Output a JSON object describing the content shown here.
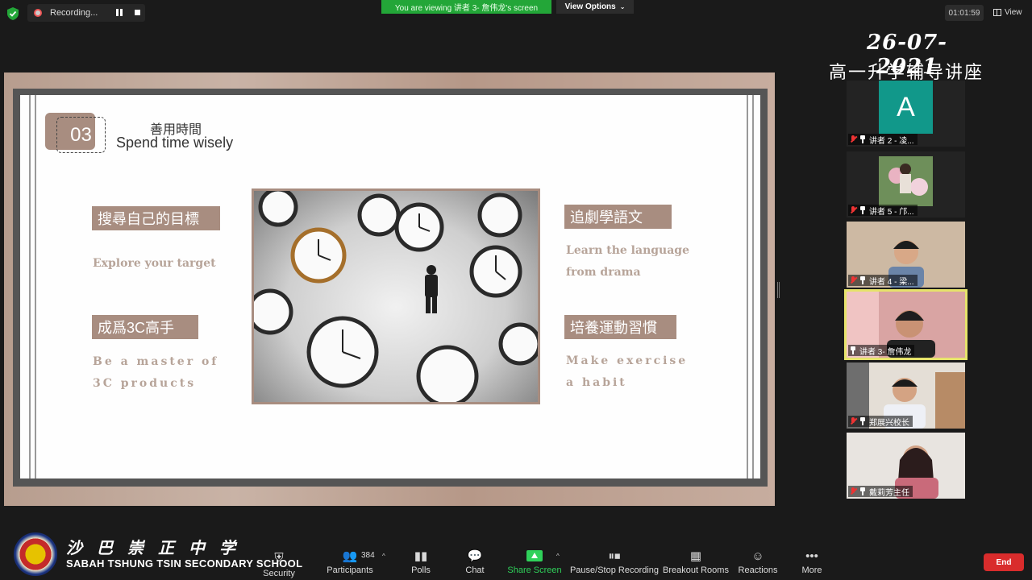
{
  "top_bar": {
    "recording_label": "Recording...",
    "viewing_banner": "You are viewing 讲者 3- 詹伟龙's screen",
    "view_options_label": "View Options",
    "timer": "01:01:59",
    "view_label": "View"
  },
  "overlay": {
    "date": "26-07-2021",
    "event_title": "高一升学辅导讲座"
  },
  "slide": {
    "section_number": "03",
    "section_title_zh": "善用時間",
    "section_title_en": "Spend time wisely",
    "items": [
      {
        "tag": "搜尋自己的目標",
        "desc_lines": [
          "Explore your target"
        ]
      },
      {
        "tag": "成爲3C高手",
        "desc_lines": [
          "Be a master of",
          "3C products"
        ]
      },
      {
        "tag": "追劇學語文",
        "desc_lines": [
          "Learn the language",
          "from drama"
        ]
      },
      {
        "tag": "培養運動習慣",
        "desc_lines": [
          "Make exercise",
          "a habit"
        ]
      }
    ]
  },
  "participants": [
    {
      "name": "讲者 2 - 凌...",
      "avatar_letter": "A",
      "muted": true
    },
    {
      "name": "讲者 5 - 邝...",
      "muted": true
    },
    {
      "name": "讲者 4 - 梁...",
      "muted": true
    },
    {
      "name": "讲者 3- 詹伟龙",
      "muted": false,
      "active": true
    },
    {
      "name": "郑展兴校长",
      "muted": true
    },
    {
      "name": "戴莉芳主任",
      "muted": true
    }
  ],
  "school": {
    "name_zh": "沙巴崇正中学",
    "name_en": "SABAH TSHUNG TSIN SECONDARY SCHOOL"
  },
  "toolbar": {
    "security": "Security",
    "participants": "Participants",
    "participant_count": "384",
    "polls": "Polls",
    "chat": "Chat",
    "share_screen": "Share Screen",
    "pause_stop_recording": "Pause/Stop Recording",
    "breakout_rooms": "Breakout Rooms",
    "reactions": "Reactions",
    "more": "More",
    "end": "End"
  },
  "colors": {
    "accent_tag": "#a88d80",
    "share_green": "#2fd15a",
    "end_red": "#d92c2c",
    "active_border": "#e6e36b",
    "avatar_teal": "#11988a"
  }
}
